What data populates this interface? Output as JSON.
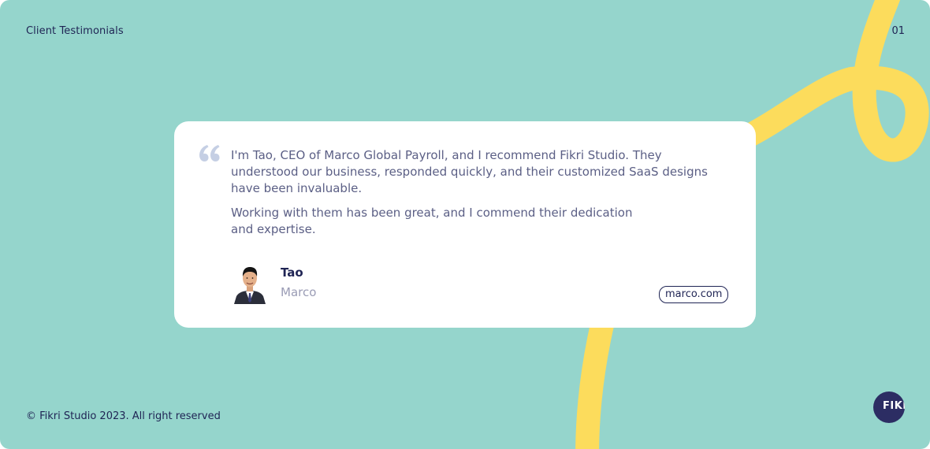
{
  "header": {
    "section_title": "Client Testimonials",
    "page_number": "01"
  },
  "testimonial": {
    "paragraphs": [
      "I'm Tao, CEO of Marco Global Payroll, and I recommend Fikri Studio. They understood our business, responded quickly, and their customized SaaS designs have been invaluable.",
      "Working with them has been great, and I commend their dedication and expertise."
    ],
    "author": {
      "name": "Tao",
      "company": "Marco"
    },
    "website": "marco.com"
  },
  "footer": {
    "copyright": "© Fikri Studio 2023. All right reserved",
    "brand_logo": "FIKRI"
  },
  "icons": {
    "quote": "quote-icon",
    "avatar": "avatar-photo"
  },
  "colors": {
    "background": "#95d5cc",
    "accent_squiggle": "#fcdc5c",
    "card": "#ffffff",
    "text_dark": "#1f2454",
    "text_body": "#5b5f85",
    "text_muted": "#9a9cb5",
    "quote_mark": "#c5cfe4",
    "badge": "#2c2d63"
  }
}
